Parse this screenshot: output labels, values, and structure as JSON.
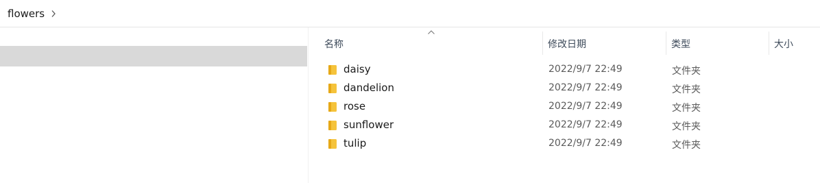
{
  "breadcrumb": {
    "current": "flowers"
  },
  "columns": {
    "name": "名称",
    "modified": "修改日期",
    "type": "类型",
    "size": "大小"
  },
  "files": [
    {
      "name": "daisy",
      "modified": "2022/9/7 22:49",
      "type": "文件夹"
    },
    {
      "name": "dandelion",
      "modified": "2022/9/7 22:49",
      "type": "文件夹"
    },
    {
      "name": "rose",
      "modified": "2022/9/7 22:49",
      "type": "文件夹"
    },
    {
      "name": "sunflower",
      "modified": "2022/9/7 22:49",
      "type": "文件夹"
    },
    {
      "name": "tulip",
      "modified": "2022/9/7 22:49",
      "type": "文件夹"
    }
  ],
  "icons": {
    "folder": "folder-icon",
    "chevron": "chevron-right-icon",
    "sort": "sort-ascending-icon"
  },
  "colors": {
    "folder": "#f5c33b",
    "selection": "#d9d9d9"
  }
}
